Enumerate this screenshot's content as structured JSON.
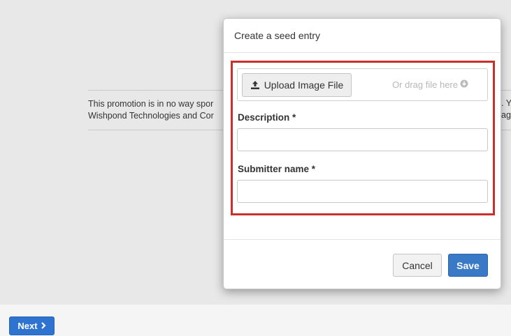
{
  "background": {
    "disclaimer_line1": "This promotion is in no way spor",
    "disclaimer_line2": "Wishpond Technologies and Cor",
    "disclaimer_right1": ". Y",
    "disclaimer_right2": "ag"
  },
  "footer": {
    "next_label": "Next",
    "next_icon": "chevron-right-icon"
  },
  "modal": {
    "title": "Create a seed entry",
    "upload": {
      "button_label": "Upload Image File",
      "button_icon": "upload-icon",
      "drag_text": "Or drag file here",
      "drag_icon": "circle-arrow-down-icon"
    },
    "fields": [
      {
        "label": "Description *",
        "value": "",
        "placeholder": ""
      },
      {
        "label": "Submitter name *",
        "value": "",
        "placeholder": ""
      }
    ],
    "cancel_label": "Cancel",
    "save_label": "Save"
  },
  "colors": {
    "highlight": "#c9302c",
    "primary": "#3979c6",
    "next": "#2f73d0"
  }
}
